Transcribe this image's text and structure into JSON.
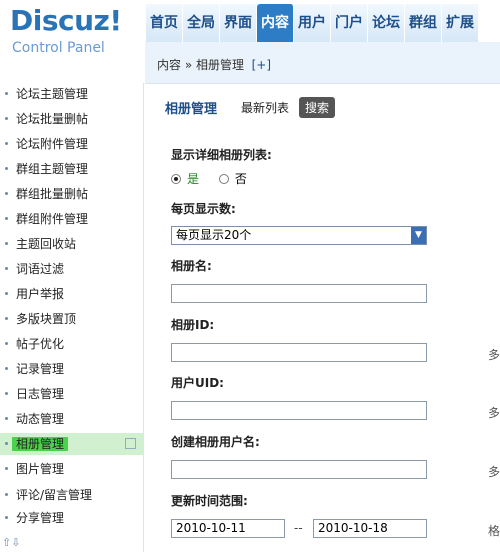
{
  "logo": {
    "name": "Discuz!",
    "subtitle": "Control Panel"
  },
  "topnav": {
    "tabs": [
      {
        "label": "首页"
      },
      {
        "label": "全局"
      },
      {
        "label": "界面"
      },
      {
        "label": "内容",
        "active": true
      },
      {
        "label": "用户"
      },
      {
        "label": "门户"
      },
      {
        "label": "论坛"
      },
      {
        "label": "群组"
      },
      {
        "label": "扩展"
      }
    ]
  },
  "sidebar": {
    "items": [
      {
        "label": "论坛主题管理"
      },
      {
        "label": "论坛批量删帖"
      },
      {
        "label": "论坛附件管理"
      },
      {
        "label": "群组主题管理"
      },
      {
        "label": "群组批量删帖"
      },
      {
        "label": "群组附件管理"
      },
      {
        "label": "主题回收站"
      },
      {
        "label": "词语过滤"
      },
      {
        "label": "用户举报"
      },
      {
        "label": "多版块置顶"
      },
      {
        "label": "帖子优化"
      },
      {
        "label": "记录管理"
      },
      {
        "label": "日志管理"
      },
      {
        "label": "动态管理"
      },
      {
        "label": "相册管理",
        "active": true
      },
      {
        "label": "图片管理"
      },
      {
        "label": "评论/留言管理"
      },
      {
        "label": "分享管理"
      }
    ],
    "scroll_arrows": "⇧⇩"
  },
  "breadcrumb": {
    "path": "内容 » 相册管理",
    "add": "[+]"
  },
  "subheader": {
    "title": "相册管理",
    "link": "最新列表",
    "search_button": "搜索"
  },
  "form": {
    "detail_label": "显示详细相册列表:",
    "yes": "是",
    "no": "否",
    "per_page_label": "每页显示数:",
    "per_page_value": "每页显示20个",
    "album_name_label": "相册名:",
    "album_name_value": "",
    "album_id_label": "相册ID:",
    "album_id_value": "",
    "album_id_hint": "多",
    "user_uid_label": "用户UID:",
    "user_uid_value": "",
    "user_uid_hint": "多",
    "creator_label": "创建相册用户名:",
    "creator_value": "",
    "creator_hint": "多",
    "time_range_label": "更新时间范围:",
    "time_from": "2010-10-11",
    "time_sep": "--",
    "time_to": "2010-10-18",
    "time_hint": "格"
  },
  "colors": {
    "brand": "#2b73b7",
    "active_tab": "#2d7dc6",
    "active_side": "#4bd14b",
    "radio_yes": "#1a8a1a"
  }
}
